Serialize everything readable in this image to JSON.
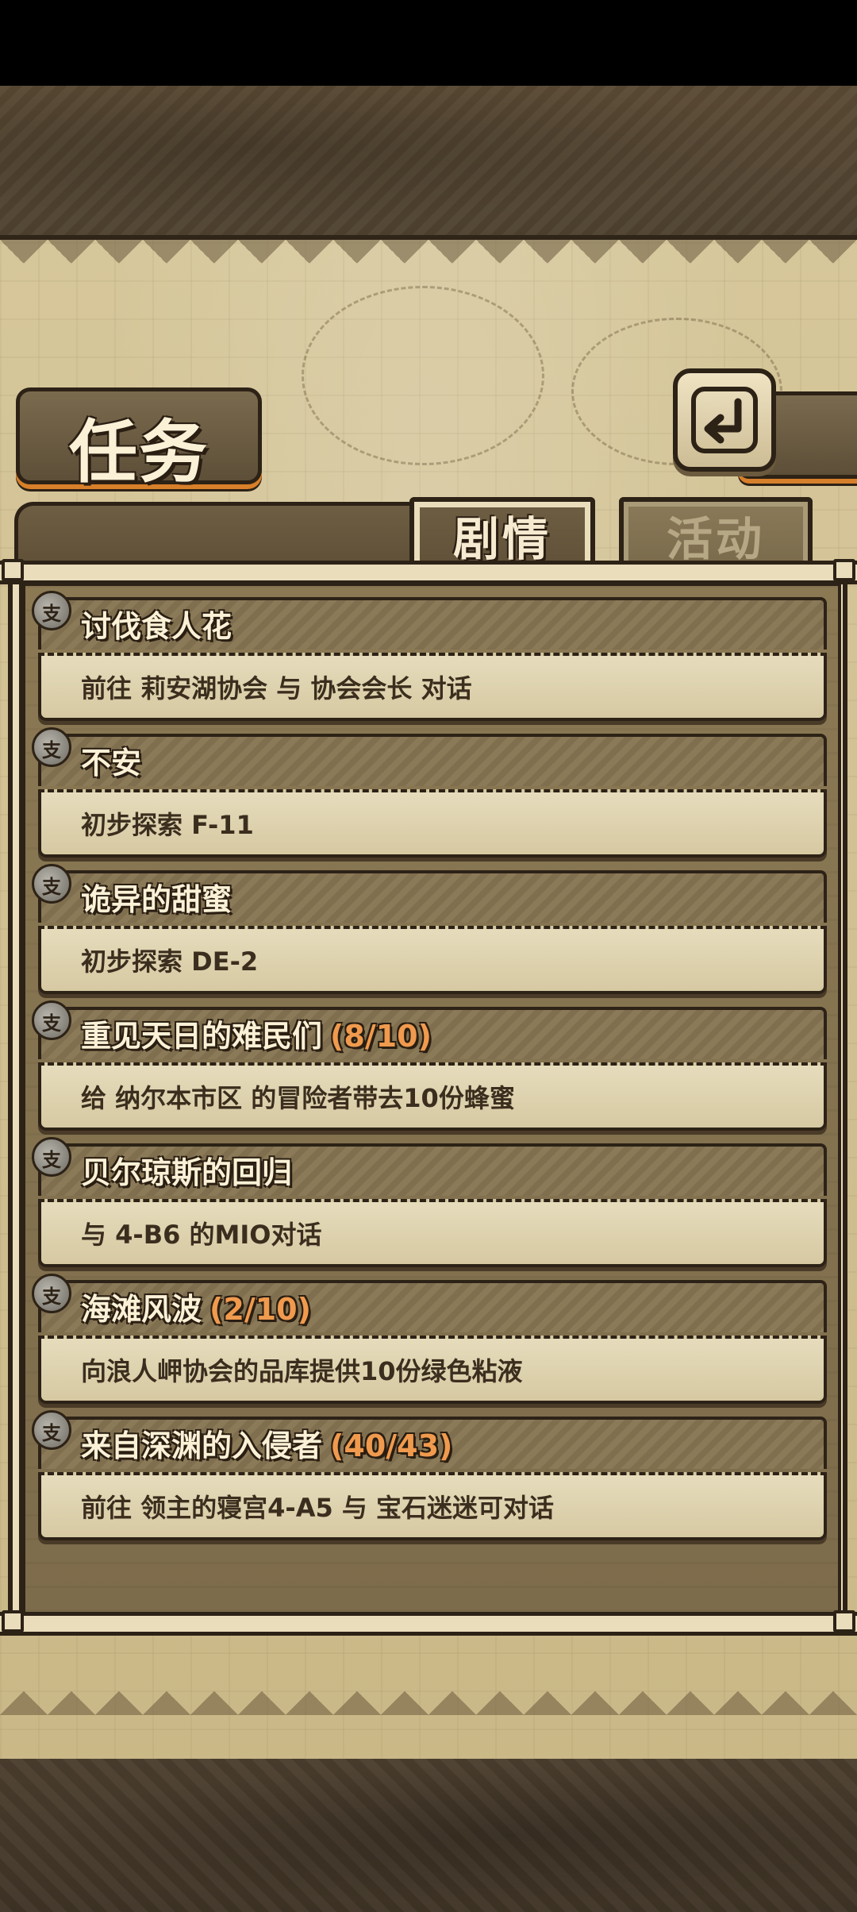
{
  "header": {
    "title": "任务",
    "back_icon": "back-arrow-icon"
  },
  "tabs": [
    {
      "label": "剧情",
      "active": true
    },
    {
      "label": "活动",
      "active": false
    }
  ],
  "quests": [
    {
      "title": "讨伐食人花",
      "progress": "",
      "description": "前往 莉安湖协会 与 协会会长 对话",
      "icon": "quest-badge-icon"
    },
    {
      "title": "不安",
      "progress": "",
      "description": "初步探索 F-11",
      "icon": "quest-badge-icon"
    },
    {
      "title": "诡异的甜蜜",
      "progress": "",
      "description": "初步探索 DE-2",
      "icon": "quest-badge-icon"
    },
    {
      "title": "重见天日的难民们",
      "progress": "(8/10)",
      "description": "给 纳尔本市区 的冒险者带去10份蜂蜜",
      "icon": "quest-badge-icon"
    },
    {
      "title": "贝尔琼斯的回归",
      "progress": "",
      "description": "与 4-B6 的MIO对话",
      "icon": "quest-badge-icon"
    },
    {
      "title": "海滩风波",
      "progress": "(2/10)",
      "description": "向浪人岬协会的品库提供10份绿色粘液",
      "icon": "quest-badge-icon"
    },
    {
      "title": "来自深渊的入侵者",
      "progress": "(40/43)",
      "description": "前往 领主的寝宫4-A5 与 宝石迷迷可对话",
      "icon": "quest-badge-icon"
    }
  ],
  "colors": {
    "parchment": "#d6c79b",
    "frame": "#2d2216",
    "title_text": "#fbf1d6",
    "progress_text": "#f09a4e",
    "accent_orange": "#d77f2a"
  }
}
